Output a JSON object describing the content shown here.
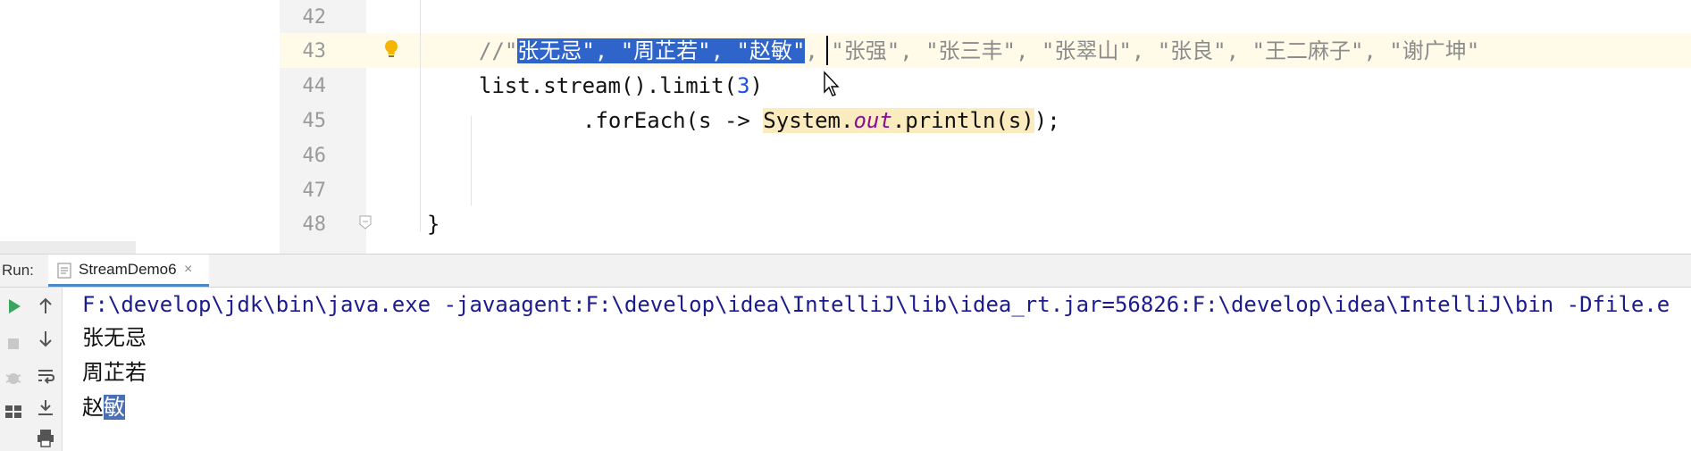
{
  "editor": {
    "lines": [
      {
        "number": "42",
        "tokens": []
      },
      {
        "number": "43",
        "tokens": [
          {
            "text": "//\"",
            "style": "comment"
          },
          {
            "text": "张无忌\", \"周芷若\", \"赵敏\"",
            "style": "sel"
          },
          {
            "text": ", \"张强\", \"张三丰\", \"张翠山\", \"张良\", \"王二麻子\", \"谢广坤\"",
            "style": "comment"
          }
        ]
      },
      {
        "number": "44",
        "tokens": [
          {
            "text": "list.stream().limit(",
            "style": ""
          },
          {
            "text": "3",
            "style": "num"
          },
          {
            "text": ")",
            "style": ""
          }
        ]
      },
      {
        "number": "45",
        "tokens": [
          {
            "text": ".forEach(s -> ",
            "style": ""
          },
          {
            "text": "System.",
            "style": "sysout"
          },
          {
            "text": "out",
            "style": "sysout static-field"
          },
          {
            "text": ".println(s)",
            "style": "sysout"
          },
          {
            "text": ");",
            "style": ""
          }
        ]
      },
      {
        "number": "46",
        "tokens": []
      },
      {
        "number": "47",
        "tokens": []
      },
      {
        "number": "48",
        "tokens": [
          {
            "text": "}",
            "style": ""
          }
        ]
      }
    ],
    "icons": {
      "bulb": "lightbulb-icon",
      "fold": "fold-marker-icon",
      "cursor": "mouse-pointer-icon"
    }
  },
  "run_panel": {
    "label": "Run:",
    "tab_title": "StreamDemo6",
    "tab_close": "×",
    "toolbar": [
      {
        "name": "rerun-icon"
      },
      {
        "name": "scroll-up-icon"
      },
      {
        "name": "stop-icon"
      },
      {
        "name": "scroll-down-icon"
      },
      {
        "name": "debug-icon"
      },
      {
        "name": "soft-wrap-icon"
      },
      {
        "name": "layout-icon"
      },
      {
        "name": "scroll-to-end-icon"
      },
      {
        "name": "print-icon"
      }
    ],
    "console": {
      "command": "F:\\develop\\jdk\\bin\\java.exe -javaagent:F:\\develop\\idea\\IntelliJ\\lib\\idea_rt.jar=56826:F:\\develop\\idea\\IntelliJ\\bin -Dfile.e",
      "output": [
        {
          "text": "张无忌",
          "selected": ""
        },
        {
          "text": "周芷若",
          "selected": ""
        },
        {
          "text": "赵",
          "selected": "敏"
        }
      ]
    }
  },
  "colors": {
    "selection": "#2f65ca",
    "line_highlight": "#fffbe8",
    "command_text": "#1b1b8f",
    "tab_underline": "#4a88c7"
  }
}
